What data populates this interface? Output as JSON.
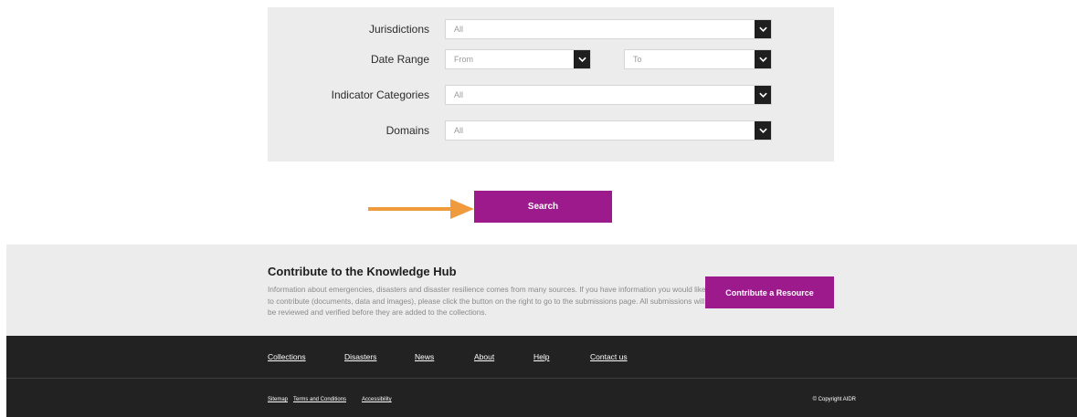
{
  "filters": {
    "jurisdictions": {
      "label": "Jurisdictions",
      "value": "All"
    },
    "date_range": {
      "label": "Date Range",
      "from": "From",
      "to": "To"
    },
    "indicator_categories": {
      "label": "Indicator Categories",
      "value": "All"
    },
    "domains": {
      "label": "Domains",
      "value": "All"
    }
  },
  "search": {
    "label": "Search",
    "arrow_color": "#f09a3e"
  },
  "contribute": {
    "title": "Contribute to the Knowledge Hub",
    "text": "Information about emergencies, disasters and disaster resilience comes from many sources. If you have information you would like to contribute (documents, data and images), please click the button on the right to go to the submissions page. All submissions will be reviewed and verified before they are added to the collections.",
    "button_label": "Contribute a Resource"
  },
  "footer": {
    "nav": [
      "Collections",
      "Disasters",
      "News",
      "About",
      "Help",
      "Contact us"
    ],
    "legal": [
      "Sitemap",
      "Terms and Conditions",
      "Accessibility"
    ],
    "copyright": "© Copyright AIDR"
  },
  "colors": {
    "accent": "#9c1a8c",
    "footer_bg": "#222222",
    "panel_bg": "#ececec"
  }
}
